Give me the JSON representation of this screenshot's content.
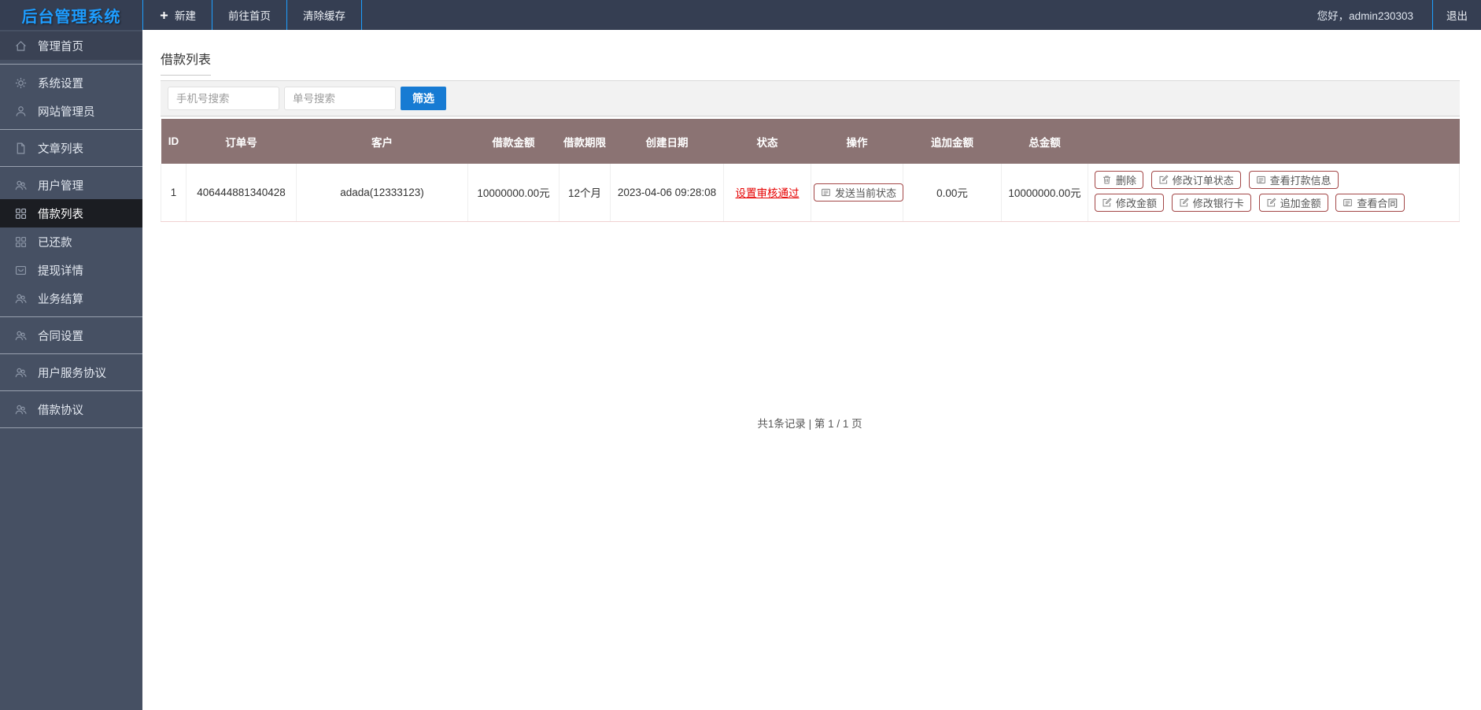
{
  "topbar": {
    "logo": "后台管理系统",
    "nav": [
      {
        "label": "新建",
        "icon": "plus-icon"
      },
      {
        "label": "前往首页"
      },
      {
        "label": "清除缓存"
      }
    ],
    "greeting": "您好，admin230303",
    "logout": "退出"
  },
  "sidebar": {
    "items": [
      {
        "label": "管理首页",
        "icon": "home-icon"
      },
      {
        "label": "系统设置",
        "icon": "gear-icon"
      },
      {
        "label": "网站管理员",
        "icon": "user-icon"
      },
      {
        "label": "文章列表",
        "icon": "document-icon"
      },
      {
        "label": "用户管理",
        "icon": "users-icon"
      },
      {
        "label": "借款列表",
        "icon": "grid-icon",
        "active": true
      },
      {
        "label": "已还款",
        "icon": "grid-icon"
      },
      {
        "label": "提现详情",
        "icon": "box-icon"
      },
      {
        "label": "业务结算",
        "icon": "users-icon"
      },
      {
        "label": "合同设置",
        "icon": "users-icon"
      },
      {
        "label": "用户服务协议",
        "icon": "users-icon"
      },
      {
        "label": "借款协议",
        "icon": "users-icon"
      }
    ]
  },
  "main": {
    "title": "借款列表",
    "toolbar": {
      "phone_placeholder": "手机号搜索",
      "order_placeholder": "单号搜索",
      "filter_label": "筛选"
    },
    "table": {
      "headers": [
        "ID",
        "订单号",
        "客户",
        "借款金额",
        "借款期限",
        "创建日期",
        "状态",
        "操作",
        "追加金额",
        "总金额",
        ""
      ],
      "row": {
        "id": "1",
        "order_no": "406444881340428",
        "customer": "adada(12333123)",
        "loan_amount": "10000000.00元",
        "loan_term": "12个月",
        "created_at": "2023-04-06 09:28:08",
        "status": "设置审核通过",
        "send_status_label": "发送当前状态",
        "extra_amount": "0.00元",
        "total_amount": "10000000.00元",
        "actions_row1": [
          {
            "label": "删除",
            "icon": "trash-icon"
          },
          {
            "label": "修改订单状态",
            "icon": "edit-icon"
          },
          {
            "label": "查看打款信息",
            "icon": "list-icon"
          }
        ],
        "actions_row2": [
          {
            "label": "修改金额",
            "icon": "edit-icon"
          },
          {
            "label": "修改银行卡",
            "icon": "edit-icon"
          },
          {
            "label": "追加金额",
            "icon": "edit-icon"
          },
          {
            "label": "查看合同",
            "icon": "list-icon"
          }
        ]
      }
    },
    "pagination": "共1条记录 | 第 1 / 1 页"
  },
  "colors": {
    "topbar_bg": "#353e52",
    "sidebar_bg": "#465063",
    "active_item_bg": "#1b1d22",
    "accent_blue": "#1e9fff",
    "logo_blue": "#1e9dff",
    "filter_button_blue": "#177bd3",
    "table_header_mauve": "#8b7373",
    "status_red": "#e60000",
    "action_button_border": "#a34747"
  }
}
